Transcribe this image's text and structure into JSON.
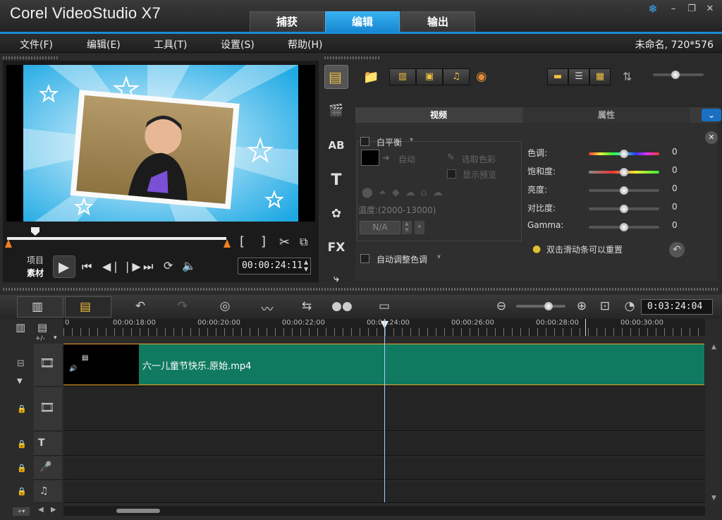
{
  "app": {
    "title": "Corel VideoStudio X7",
    "modes": [
      "捕获",
      "编辑",
      "输出"
    ],
    "active_mode": 1
  },
  "menu": {
    "items": [
      "文件(F)",
      "编辑(E)",
      "工具(T)",
      "设置(S)",
      "帮助(H)"
    ],
    "project_info": "未命名, 720*576"
  },
  "player": {
    "labels": {
      "project": "项目",
      "clip": "素材"
    },
    "timecode": "00:00:24:11",
    "scrub_position": 0.14
  },
  "options": {
    "tabs": [
      "视频",
      "属性"
    ],
    "active_tab": 0,
    "white_balance": {
      "label": "白平衡",
      "auto": "自动",
      "pick_color": "选取色彩",
      "show_preview": "显示预览",
      "temp_label": "温度:(2000-13000)",
      "temp_value": "N/A"
    },
    "auto_tone": "自动调整色调",
    "adjust": [
      {
        "label": "色调:",
        "value": "0"
      },
      {
        "label": "饱和度:",
        "value": "0"
      },
      {
        "label": "亮度:",
        "value": "0"
      },
      {
        "label": "对比度:",
        "value": "0"
      },
      {
        "label": "Gamma:",
        "value": "0"
      }
    ],
    "hint": "双击滑动条可以重置"
  },
  "timeline": {
    "timecode": "0:03:24:04",
    "ruler": [
      "00:00:18:00",
      "00:00:20:00",
      "00:00:22:00",
      "00:00:24:00",
      "00:00:26:00",
      "00:00:28:00",
      "00:00:30:00"
    ],
    "ruler_start": "0",
    "clip_name": "六一儿童节快乐.原始.mp4",
    "add_label": "+/-"
  },
  "colors": {
    "accent": "#1a8ad9",
    "clip": "#107a60"
  }
}
